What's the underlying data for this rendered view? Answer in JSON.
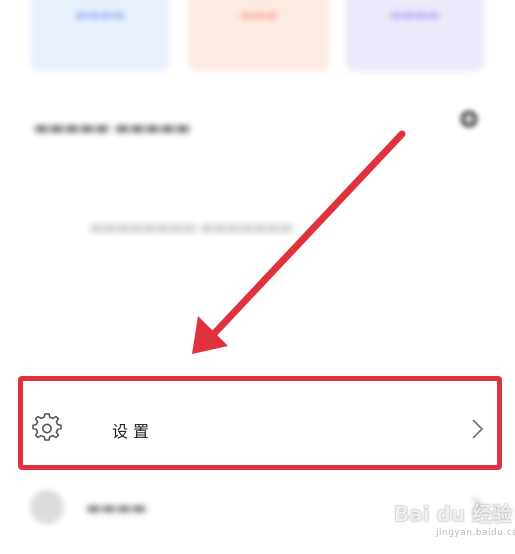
{
  "settings_item": {
    "label": "设置",
    "icon": "gear-icon",
    "chevron": "chevron-right-icon"
  },
  "highlight": {
    "color": "#e0323c"
  },
  "watermark": {
    "text": "Bai du 经验",
    "sub": "jingyan.baidu.com"
  },
  "colors": {
    "card_blue": "#eaf1fe",
    "card_orange": "#fdece4",
    "card_purple": "#eeeafc",
    "annotation_red": "#e0323c"
  }
}
